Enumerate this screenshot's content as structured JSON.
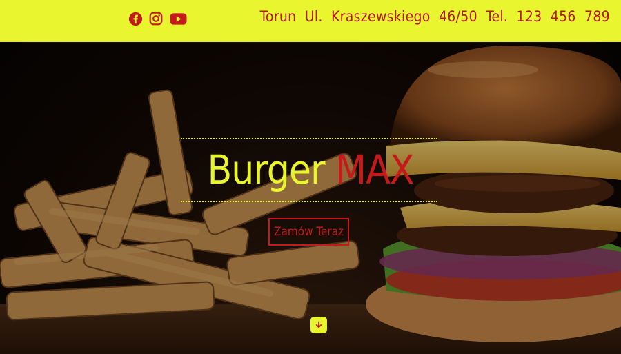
{
  "header": {
    "social": [
      {
        "name": "facebook-icon"
      },
      {
        "name": "instagram-icon"
      },
      {
        "name": "youtube-icon"
      }
    ],
    "contact": "Torun Ul. Kraszewskiego 46/50 Tel. 123 456 789"
  },
  "hero": {
    "title_part1": "Burger",
    "title_part2": "MAX",
    "cta_label": "Zamów Teraz",
    "scroll_icon": "arrow-down-icon"
  },
  "colors": {
    "accent_yellow": "#e8f52f",
    "accent_red": "#c41a1a"
  }
}
